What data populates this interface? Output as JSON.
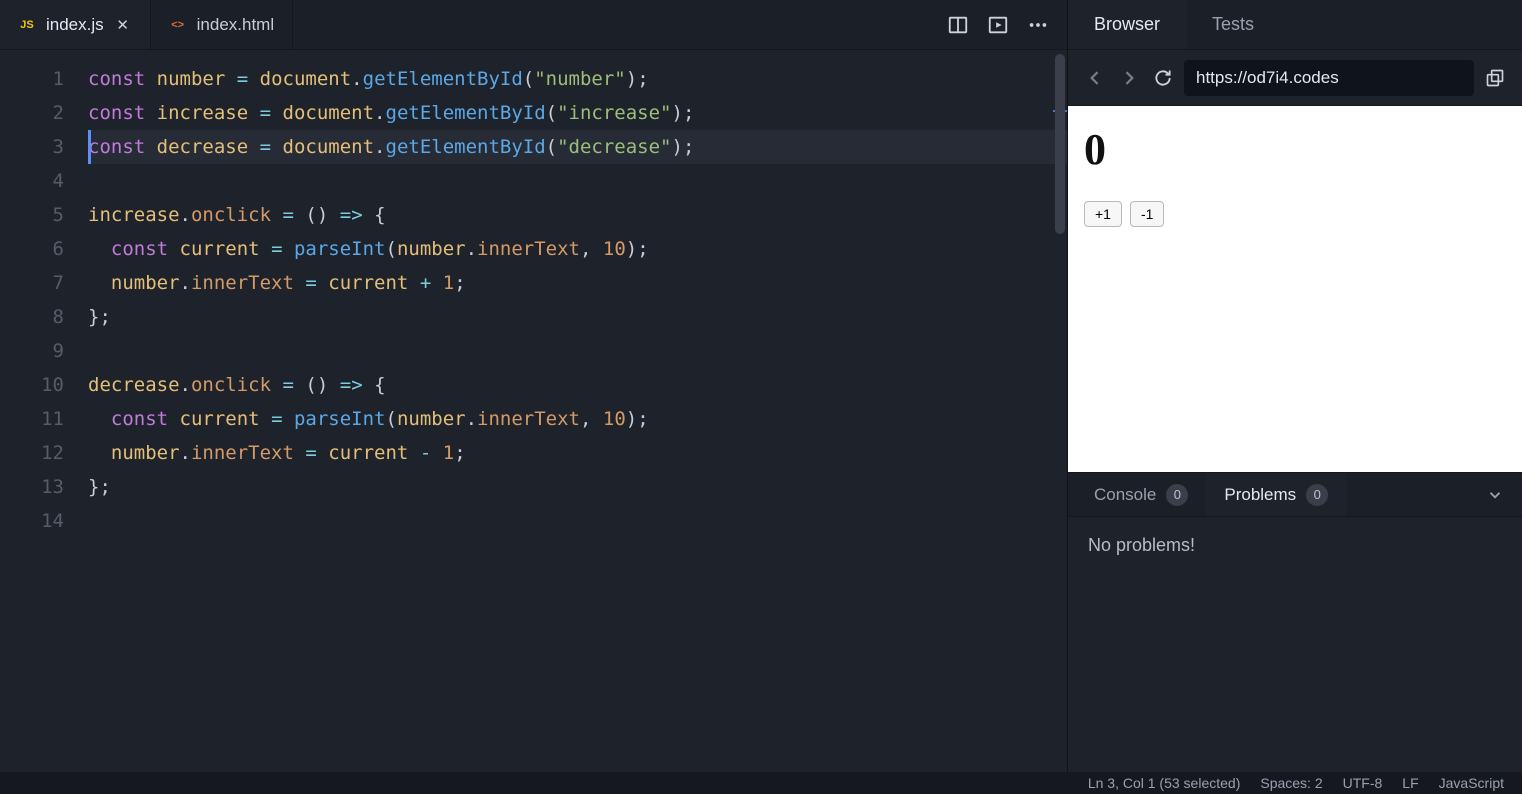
{
  "tabs": [
    {
      "label": "index.js",
      "icon": "JS",
      "active": true,
      "closeable": true
    },
    {
      "label": "index.html",
      "icon": "<>",
      "active": false,
      "closeable": false
    }
  ],
  "toolbar_icons": [
    "split-editor-icon",
    "preview-icon",
    "more-icon"
  ],
  "code_lines": [
    {
      "n": 1,
      "hl": false,
      "tokens": [
        [
          "kw",
          "const"
        ],
        [
          "",
          ""
        ],
        [
          "var",
          "number"
        ],
        [
          "",
          ""
        ],
        [
          "op",
          "="
        ],
        [
          "",
          ""
        ],
        [
          "obj",
          "document"
        ],
        [
          "punc",
          "."
        ],
        [
          "fn",
          "getElementById"
        ],
        [
          "punc",
          "("
        ],
        [
          "str",
          "\"number\""
        ],
        [
          "punc",
          ")"
        ],
        [
          "punc",
          ";"
        ]
      ]
    },
    {
      "n": 2,
      "hl": false,
      "tokens": [
        [
          "kw",
          "const"
        ],
        [
          "",
          ""
        ],
        [
          "var",
          "increase"
        ],
        [
          "",
          ""
        ],
        [
          "op",
          "="
        ],
        [
          "",
          ""
        ],
        [
          "obj",
          "document"
        ],
        [
          "punc",
          "."
        ],
        [
          "fn",
          "getElementById"
        ],
        [
          "punc",
          "("
        ],
        [
          "str",
          "\"increase\""
        ],
        [
          "punc",
          ")"
        ],
        [
          "punc",
          ";"
        ]
      ]
    },
    {
      "n": 3,
      "hl": true,
      "tokens": [
        [
          "kw",
          "const"
        ],
        [
          "",
          ""
        ],
        [
          "var",
          "decrease"
        ],
        [
          "",
          ""
        ],
        [
          "op",
          "="
        ],
        [
          "",
          ""
        ],
        [
          "obj",
          "document"
        ],
        [
          "punc",
          "."
        ],
        [
          "fn",
          "getElementById"
        ],
        [
          "punc",
          "("
        ],
        [
          "str",
          "\"decrease\""
        ],
        [
          "punc",
          ")"
        ],
        [
          "punc",
          ";"
        ]
      ]
    },
    {
      "n": 4,
      "hl": false,
      "tokens": []
    },
    {
      "n": 5,
      "hl": false,
      "tokens": [
        [
          "var",
          "increase"
        ],
        [
          "punc",
          "."
        ],
        [
          "prop",
          "onclick"
        ],
        [
          "",
          ""
        ],
        [
          "op",
          "="
        ],
        [
          "",
          ""
        ],
        [
          "punc",
          "("
        ],
        [
          "punc",
          ")"
        ],
        [
          "",
          ""
        ],
        [
          "op",
          "=>"
        ],
        [
          "",
          ""
        ],
        [
          "punc",
          "{"
        ]
      ]
    },
    {
      "n": 6,
      "hl": false,
      "tokens": [
        [
          "",
          "  "
        ],
        [
          "kw",
          "const"
        ],
        [
          "",
          ""
        ],
        [
          "var",
          "current"
        ],
        [
          "",
          ""
        ],
        [
          "op",
          "="
        ],
        [
          "",
          ""
        ],
        [
          "fn",
          "parseInt"
        ],
        [
          "punc",
          "("
        ],
        [
          "var",
          "number"
        ],
        [
          "punc",
          "."
        ],
        [
          "prop",
          "innerText"
        ],
        [
          "punc",
          ","
        ],
        [
          "",
          ""
        ],
        [
          "num",
          "10"
        ],
        [
          "punc",
          ")"
        ],
        [
          "punc",
          ";"
        ]
      ]
    },
    {
      "n": 7,
      "hl": false,
      "tokens": [
        [
          "",
          "  "
        ],
        [
          "var",
          "number"
        ],
        [
          "punc",
          "."
        ],
        [
          "prop",
          "innerText"
        ],
        [
          "",
          ""
        ],
        [
          "op",
          "="
        ],
        [
          "",
          ""
        ],
        [
          "var",
          "current"
        ],
        [
          "",
          ""
        ],
        [
          "op",
          "+"
        ],
        [
          "",
          ""
        ],
        [
          "num",
          "1"
        ],
        [
          "punc",
          ";"
        ]
      ]
    },
    {
      "n": 8,
      "hl": false,
      "tokens": [
        [
          "punc",
          "}"
        ],
        [
          "punc",
          ";"
        ]
      ]
    },
    {
      "n": 9,
      "hl": false,
      "tokens": []
    },
    {
      "n": 10,
      "hl": false,
      "tokens": [
        [
          "var",
          "decrease"
        ],
        [
          "punc",
          "."
        ],
        [
          "prop",
          "onclick"
        ],
        [
          "",
          ""
        ],
        [
          "op",
          "="
        ],
        [
          "",
          ""
        ],
        [
          "punc",
          "("
        ],
        [
          "punc",
          ")"
        ],
        [
          "",
          ""
        ],
        [
          "op",
          "=>"
        ],
        [
          "",
          ""
        ],
        [
          "punc",
          "{"
        ]
      ]
    },
    {
      "n": 11,
      "hl": false,
      "tokens": [
        [
          "",
          "  "
        ],
        [
          "kw",
          "const"
        ],
        [
          "",
          ""
        ],
        [
          "var",
          "current"
        ],
        [
          "",
          ""
        ],
        [
          "op",
          "="
        ],
        [
          "",
          ""
        ],
        [
          "fn",
          "parseInt"
        ],
        [
          "punc",
          "("
        ],
        [
          "var",
          "number"
        ],
        [
          "punc",
          "."
        ],
        [
          "prop",
          "innerText"
        ],
        [
          "punc",
          ","
        ],
        [
          "",
          ""
        ],
        [
          "num",
          "10"
        ],
        [
          "punc",
          ")"
        ],
        [
          "punc",
          ";"
        ]
      ]
    },
    {
      "n": 12,
      "hl": false,
      "tokens": [
        [
          "",
          "  "
        ],
        [
          "var",
          "number"
        ],
        [
          "punc",
          "."
        ],
        [
          "prop",
          "innerText"
        ],
        [
          "",
          ""
        ],
        [
          "op",
          "="
        ],
        [
          "",
          ""
        ],
        [
          "var",
          "current"
        ],
        [
          "",
          ""
        ],
        [
          "op",
          "-"
        ],
        [
          "",
          ""
        ],
        [
          "num",
          "1"
        ],
        [
          "punc",
          ";"
        ]
      ]
    },
    {
      "n": 13,
      "hl": false,
      "tokens": [
        [
          "punc",
          "}"
        ],
        [
          "punc",
          ";"
        ]
      ]
    },
    {
      "n": 14,
      "hl": false,
      "tokens": []
    }
  ],
  "right_tabs": [
    {
      "label": "Browser",
      "active": true
    },
    {
      "label": "Tests",
      "active": false
    }
  ],
  "browser": {
    "url": "https://od7i4.codes",
    "page": {
      "number": "0",
      "btn_plus": "+1",
      "btn_minus": "-1"
    }
  },
  "devpanel": {
    "tabs": [
      {
        "label": "Console",
        "count": "0",
        "active": false
      },
      {
        "label": "Problems",
        "count": "0",
        "active": true
      }
    ],
    "body": "No problems!"
  },
  "statusbar": {
    "pos": "Ln 3, Col 1 (53 selected)",
    "spaces": "Spaces: 2",
    "encoding": "UTF-8",
    "eol": "LF",
    "lang": "JavaScript"
  }
}
